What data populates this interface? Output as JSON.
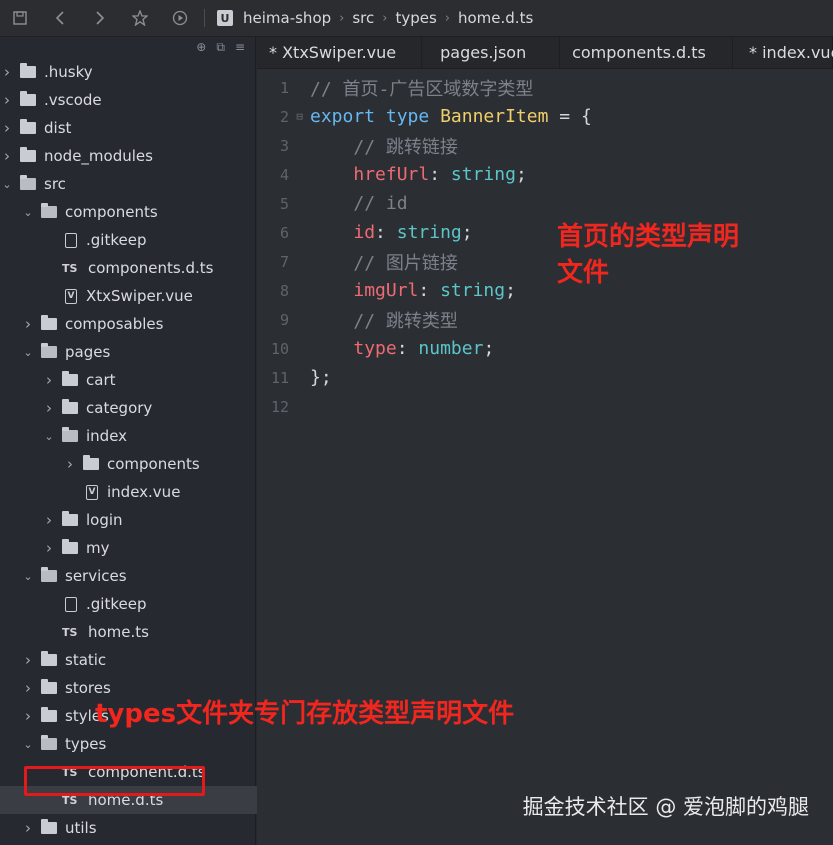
{
  "toolbar": {
    "icons": [
      "save-icon",
      "back-icon",
      "forward-icon",
      "star-icon",
      "run-icon"
    ],
    "breadcrumb": [
      "heima-shop",
      "src",
      "types",
      "home.d.ts"
    ]
  },
  "tabs": [
    "* XtxSwiper.vue",
    "pages.json",
    "components.d.ts",
    "* index.vue"
  ],
  "tree": [
    {
      "label": ".husky",
      "type": "folder",
      "depth": 0
    },
    {
      "label": ".vscode",
      "type": "folder",
      "depth": 0
    },
    {
      "label": "dist",
      "type": "folder",
      "depth": 0
    },
    {
      "label": "node_modules",
      "type": "folder",
      "depth": 0
    },
    {
      "label": "src",
      "type": "folder-open",
      "depth": 0
    },
    {
      "label": "components",
      "type": "folder-open",
      "depth": 1
    },
    {
      "label": ".gitkeep",
      "type": "file",
      "depth": 2
    },
    {
      "label": "components.d.ts",
      "type": "ts",
      "depth": 2
    },
    {
      "label": "XtxSwiper.vue",
      "type": "vue",
      "depth": 2
    },
    {
      "label": "composables",
      "type": "folder",
      "depth": 1
    },
    {
      "label": "pages",
      "type": "folder-open",
      "depth": 1
    },
    {
      "label": "cart",
      "type": "folder",
      "depth": 2
    },
    {
      "label": "category",
      "type": "folder",
      "depth": 2
    },
    {
      "label": "index",
      "type": "folder-open",
      "depth": 2
    },
    {
      "label": "components",
      "type": "folder",
      "depth": 3
    },
    {
      "label": "index.vue",
      "type": "vue",
      "depth": 3
    },
    {
      "label": "login",
      "type": "folder",
      "depth": 2
    },
    {
      "label": "my",
      "type": "folder",
      "depth": 2
    },
    {
      "label": "services",
      "type": "folder-open",
      "depth": 1
    },
    {
      "label": ".gitkeep",
      "type": "file",
      "depth": 2
    },
    {
      "label": "home.ts",
      "type": "ts",
      "depth": 2
    },
    {
      "label": "static",
      "type": "folder",
      "depth": 1
    },
    {
      "label": "stores",
      "type": "folder",
      "depth": 1
    },
    {
      "label": "styles",
      "type": "folder",
      "depth": 1
    },
    {
      "label": "types",
      "type": "folder-open",
      "depth": 1
    },
    {
      "label": "component.d.ts",
      "type": "ts",
      "depth": 2
    },
    {
      "label": "home.d.ts",
      "type": "ts",
      "depth": 2,
      "selected": true
    },
    {
      "label": "utils",
      "type": "folder",
      "depth": 1
    }
  ],
  "code": [
    {
      "n": "1",
      "tokens": [
        [
          "cmt",
          "// 首页-广告区域数字类型"
        ]
      ]
    },
    {
      "n": "2",
      "fold": true,
      "tokens": [
        [
          "kw",
          "export"
        ],
        [
          "pun",
          " "
        ],
        [
          "kw",
          "type"
        ],
        [
          "pun",
          " "
        ],
        [
          "ty",
          "BannerItem"
        ],
        [
          "pun",
          " = {"
        ]
      ]
    },
    {
      "n": "3",
      "tokens": [
        [
          "pun",
          "    "
        ],
        [
          "cmt",
          "// 跳转链接"
        ]
      ]
    },
    {
      "n": "4",
      "tokens": [
        [
          "pun",
          "    "
        ],
        [
          "prop",
          "hrefUrl"
        ],
        [
          "pun",
          ": "
        ],
        [
          "typ",
          "string"
        ],
        [
          "pun",
          ";"
        ]
      ]
    },
    {
      "n": "5",
      "tokens": [
        [
          "pun",
          "    "
        ],
        [
          "cmt",
          "// id"
        ]
      ]
    },
    {
      "n": "6",
      "tokens": [
        [
          "pun",
          "    "
        ],
        [
          "prop",
          "id"
        ],
        [
          "pun",
          ": "
        ],
        [
          "typ",
          "string"
        ],
        [
          "pun",
          ";"
        ]
      ]
    },
    {
      "n": "7",
      "tokens": [
        [
          "pun",
          "    "
        ],
        [
          "cmt",
          "// 图片链接"
        ]
      ]
    },
    {
      "n": "8",
      "tokens": [
        [
          "pun",
          "    "
        ],
        [
          "prop",
          "imgUrl"
        ],
        [
          "pun",
          ": "
        ],
        [
          "typ",
          "string"
        ],
        [
          "pun",
          ";"
        ]
      ]
    },
    {
      "n": "9",
      "tokens": [
        [
          "pun",
          "    "
        ],
        [
          "cmt",
          "// 跳转类型"
        ]
      ]
    },
    {
      "n": "10",
      "tokens": [
        [
          "pun",
          "    "
        ],
        [
          "prop",
          "type"
        ],
        [
          "pun",
          ": "
        ],
        [
          "typ",
          "number"
        ],
        [
          "pun",
          ";"
        ]
      ]
    },
    {
      "n": "11",
      "tokens": [
        [
          "pun",
          "};"
        ]
      ]
    },
    {
      "n": "12",
      "tokens": []
    }
  ],
  "annotations": {
    "editor_note_line1": "首页的类型声明",
    "editor_note_line2": "文件",
    "sidebar_note": "types文件夹专门存放类型声明文件"
  },
  "watermark": "掘金技术社区 @ 爱泡脚的鸡腿",
  "colors": {
    "annotation": "#f0261f",
    "keyword": "#66b8f0",
    "type_name": "#f0cf6a",
    "property": "#ef6b73",
    "builtin_type": "#5bc6c9",
    "comment": "#7c818a"
  }
}
